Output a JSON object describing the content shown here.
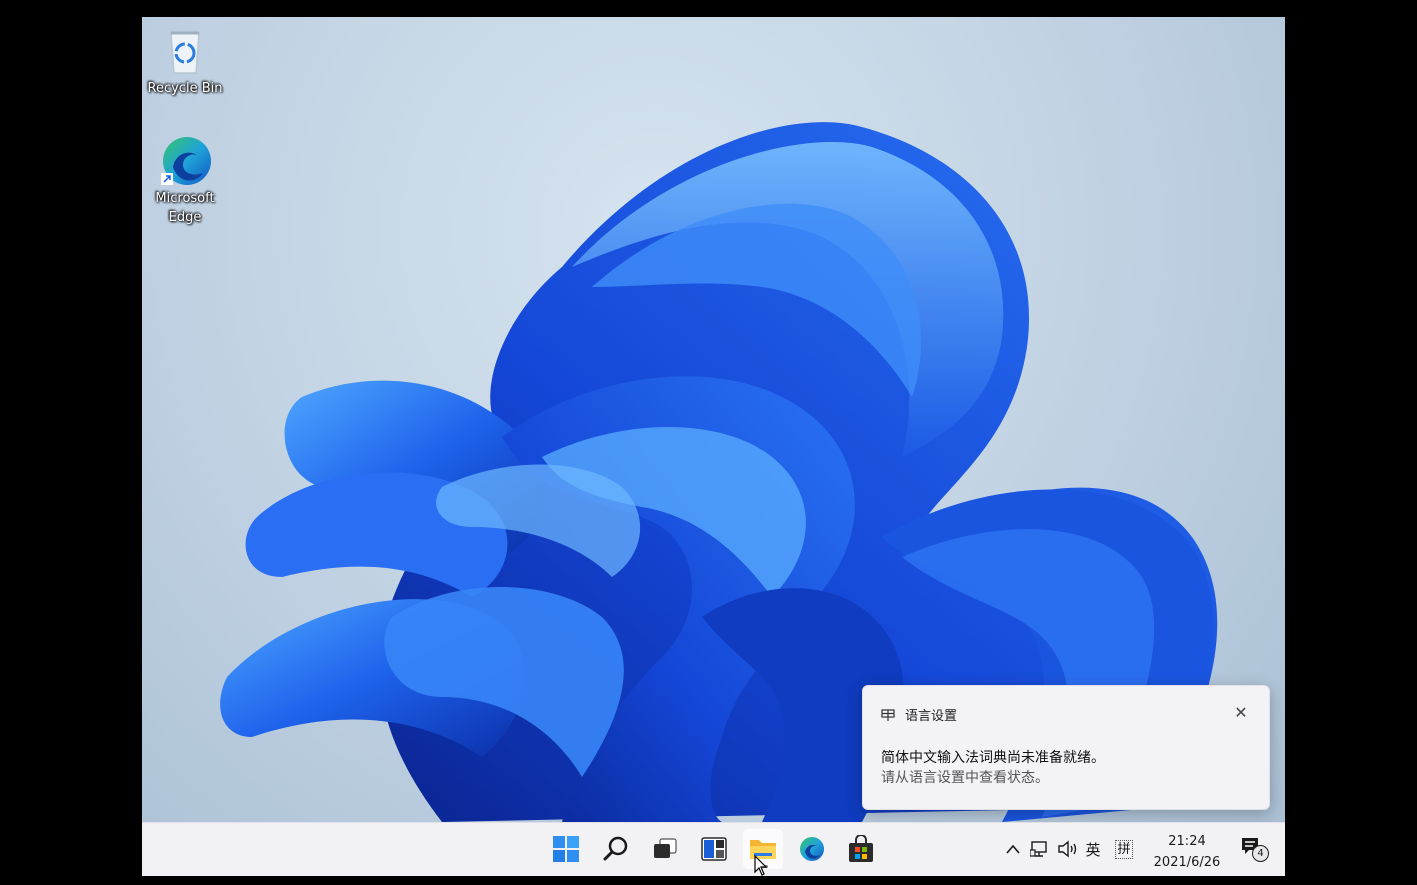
{
  "desktop": {
    "icons": [
      {
        "label": "Recycle Bin",
        "icon": "recycle-bin-icon"
      },
      {
        "label_line1": "Microsoft",
        "label_line2": "Edge",
        "icon": "edge-icon"
      }
    ]
  },
  "notification": {
    "title": "语言设置",
    "line1": "简体中文输入法词典尚未准备就绪。",
    "line2": "请从语言设置中查看状态。",
    "close_glyph": "✕"
  },
  "taskbar": {
    "apps": [
      "start-icon",
      "search-icon",
      "task-view-icon",
      "widgets-icon",
      "file-explorer-icon",
      "edge-icon",
      "store-icon"
    ],
    "active_app": "file-explorer-icon",
    "tray": {
      "chevron": "^",
      "ime_mode": "英",
      "ime_layout": "拼",
      "notifications_count": "4"
    },
    "clock": {
      "time": "21:24",
      "date": "2021/6/26"
    }
  },
  "colors": {
    "accent": "#1a5ce8",
    "bloom_dark": "#0a2fb0",
    "bloom_light": "#4aa3ff",
    "taskbar_bg": "#f2f1f4"
  }
}
